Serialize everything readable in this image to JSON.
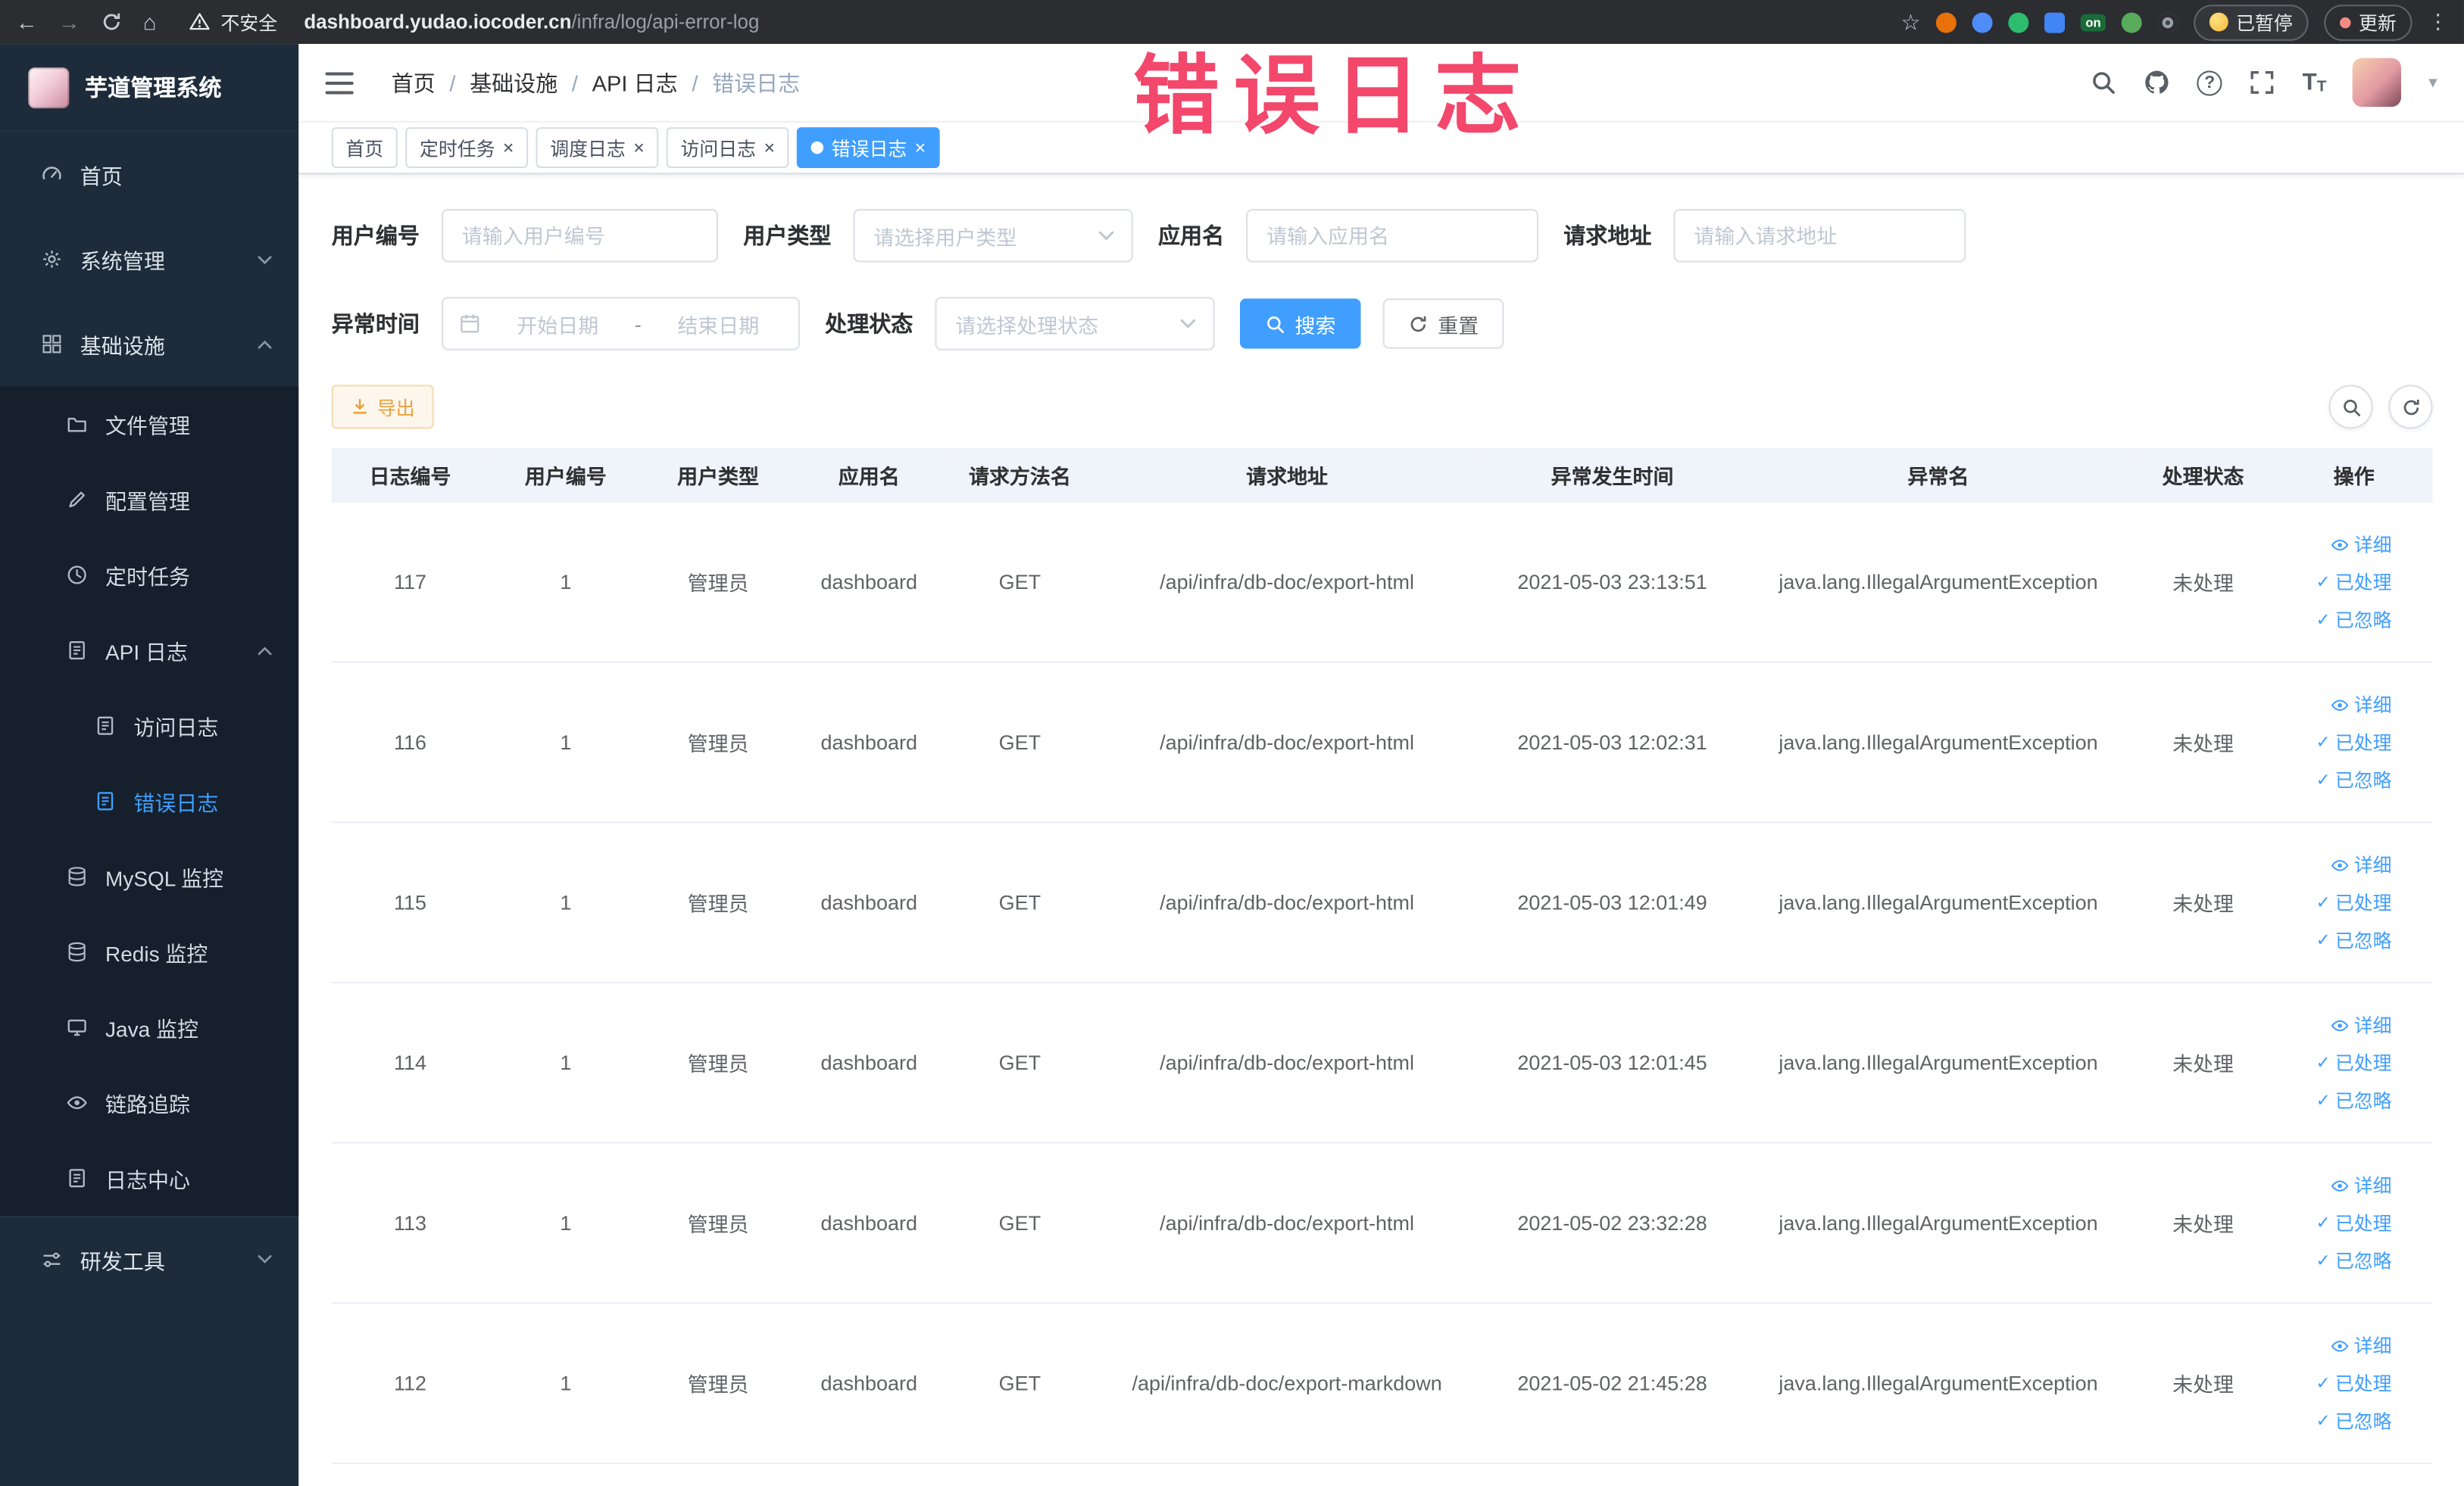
{
  "browser": {
    "security_label": "不安全",
    "url_domain": "dashboard.yudao.iocoder.cn",
    "url_path": "/infra/log/api-error-log",
    "on_badge": "on",
    "paused_label": "已暂停",
    "update_label": "更新"
  },
  "annotation": {
    "text": "错误日志",
    "color": "#F3476B"
  },
  "sidebar": {
    "logo_title": "芋道管理系统",
    "items": [
      {
        "label": "首页",
        "level": 1
      },
      {
        "label": "系统管理",
        "level": 1,
        "chevron": "down"
      },
      {
        "label": "基础设施",
        "level": 1,
        "chevron": "up"
      },
      {
        "label": "文件管理",
        "level": 2
      },
      {
        "label": "配置管理",
        "level": 2
      },
      {
        "label": "定时任务",
        "level": 2
      },
      {
        "label": "API 日志",
        "level": 2,
        "chevron": "up"
      },
      {
        "label": "访问日志",
        "level": 3
      },
      {
        "label": "错误日志",
        "level": 3,
        "active": true
      },
      {
        "label": "MySQL 监控",
        "level": 2
      },
      {
        "label": "Redis 监控",
        "level": 2
      },
      {
        "label": "Java 监控",
        "level": 2
      },
      {
        "label": "链路追踪",
        "level": 2
      },
      {
        "label": "日志中心",
        "level": 2
      },
      {
        "label": "研发工具",
        "level": 1,
        "chevron": "down"
      }
    ]
  },
  "header": {
    "breadcrumb": [
      "首页",
      "基础设施",
      "API 日志",
      "错误日志"
    ],
    "separator": "/"
  },
  "tabs": [
    {
      "label": "首页",
      "active": false,
      "closable": false
    },
    {
      "label": "定时任务",
      "active": false,
      "closable": true
    },
    {
      "label": "调度日志",
      "active": false,
      "closable": true
    },
    {
      "label": "访问日志",
      "active": false,
      "closable": true
    },
    {
      "label": "错误日志",
      "active": true,
      "closable": true
    }
  ],
  "filters": {
    "user_id": {
      "label": "用户编号",
      "placeholder": "请输入用户编号"
    },
    "user_type": {
      "label": "用户类型",
      "placeholder": "请选择用户类型"
    },
    "app_name": {
      "label": "应用名",
      "placeholder": "请输入应用名"
    },
    "request_url": {
      "label": "请求地址",
      "placeholder": "请输入请求地址"
    },
    "exception_time": {
      "label": "异常时间",
      "start_placeholder": "开始日期",
      "separator": "-",
      "end_placeholder": "结束日期"
    },
    "process_status": {
      "label": "处理状态",
      "placeholder": "请选择处理状态"
    },
    "search_label": "搜索",
    "reset_label": "重置"
  },
  "toolbar": {
    "export_label": "导出"
  },
  "table": {
    "columns": [
      "日志编号",
      "用户编号",
      "用户类型",
      "应用名",
      "请求方法名",
      "请求地址",
      "异常发生时间",
      "异常名",
      "处理状态",
      "操作"
    ],
    "actions": {
      "detail": "详细",
      "processed": "已处理",
      "ignored": "已忽略"
    },
    "rows": [
      {
        "id": "117",
        "user_id": "1",
        "user_type": "管理员",
        "app": "dashboard",
        "method": "GET",
        "url": "/api/infra/db-doc/export-html",
        "time": "2021-05-03 23:13:51",
        "exception": "java.lang.IllegalArgumentException",
        "status": "未处理"
      },
      {
        "id": "116",
        "user_id": "1",
        "user_type": "管理员",
        "app": "dashboard",
        "method": "GET",
        "url": "/api/infra/db-doc/export-html",
        "time": "2021-05-03 12:02:31",
        "exception": "java.lang.IllegalArgumentException",
        "status": "未处理"
      },
      {
        "id": "115",
        "user_id": "1",
        "user_type": "管理员",
        "app": "dashboard",
        "method": "GET",
        "url": "/api/infra/db-doc/export-html",
        "time": "2021-05-03 12:01:49",
        "exception": "java.lang.IllegalArgumentException",
        "status": "未处理"
      },
      {
        "id": "114",
        "user_id": "1",
        "user_type": "管理员",
        "app": "dashboard",
        "method": "GET",
        "url": "/api/infra/db-doc/export-html",
        "time": "2021-05-03 12:01:45",
        "exception": "java.lang.IllegalArgumentException",
        "status": "未处理"
      },
      {
        "id": "113",
        "user_id": "1",
        "user_type": "管理员",
        "app": "dashboard",
        "method": "GET",
        "url": "/api/infra/db-doc/export-html",
        "time": "2021-05-02 23:32:28",
        "exception": "java.lang.IllegalArgumentException",
        "status": "未处理"
      },
      {
        "id": "112",
        "user_id": "1",
        "user_type": "管理员",
        "app": "dashboard",
        "method": "GET",
        "url": "/api/infra/db-doc/export-markdown",
        "time": "2021-05-02 21:45:28",
        "exception": "java.lang.IllegalArgumentException",
        "status": "未处理"
      }
    ]
  },
  "colors": {
    "accent": "#409EFF",
    "warning": "#E6A23C",
    "annotation": "#F3476B",
    "sidebar_bg": "#1D2B3A",
    "active_tab": "#409EFF"
  }
}
